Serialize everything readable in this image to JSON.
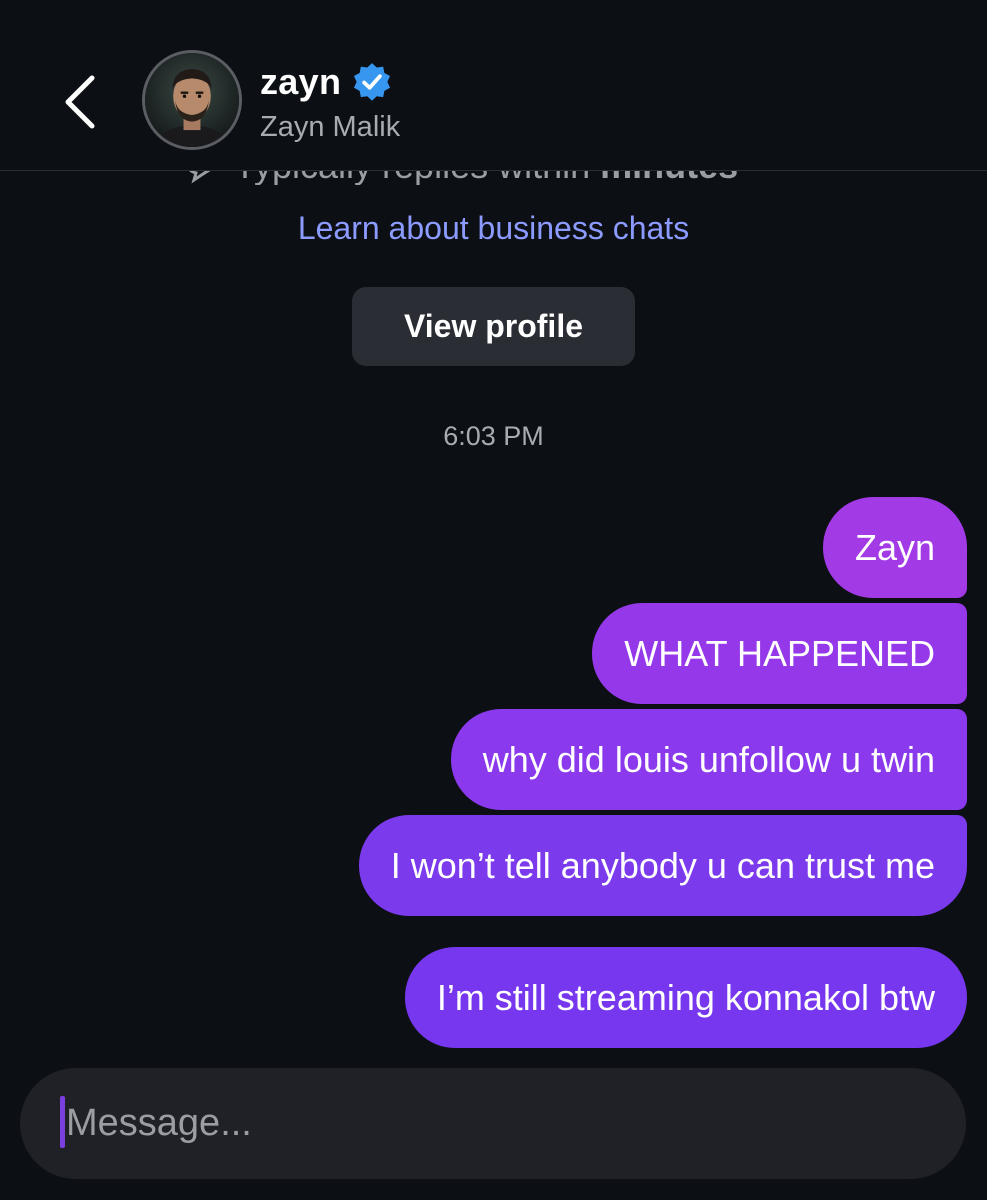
{
  "header": {
    "back_icon": "chevron-left-icon",
    "username": "zayn",
    "verified_icon": "verified-badge-icon",
    "full_name": "Zayn Malik"
  },
  "info": {
    "clipped_text": "Typically replies within",
    "clipped_bold": "minutes",
    "learn_link": "Learn about business chats",
    "view_profile_label": "View profile"
  },
  "thread": {
    "timestamp": "6:03 PM",
    "messages": [
      {
        "text": "Zayn"
      },
      {
        "text": "WHAT HAPPENED"
      },
      {
        "text": "why did louis unfollow u twin"
      },
      {
        "text": "I won’t tell anybody u can trust me"
      },
      {
        "text": "I’m still streaming konnakol btw"
      }
    ]
  },
  "composer": {
    "placeholder": "Message..."
  },
  "colors": {
    "background": "#0c0f14",
    "link": "#8c9bff",
    "verified": "#3797f0",
    "bubble_top": "#a23ae6",
    "bubble_bottom": "#7637ee"
  }
}
